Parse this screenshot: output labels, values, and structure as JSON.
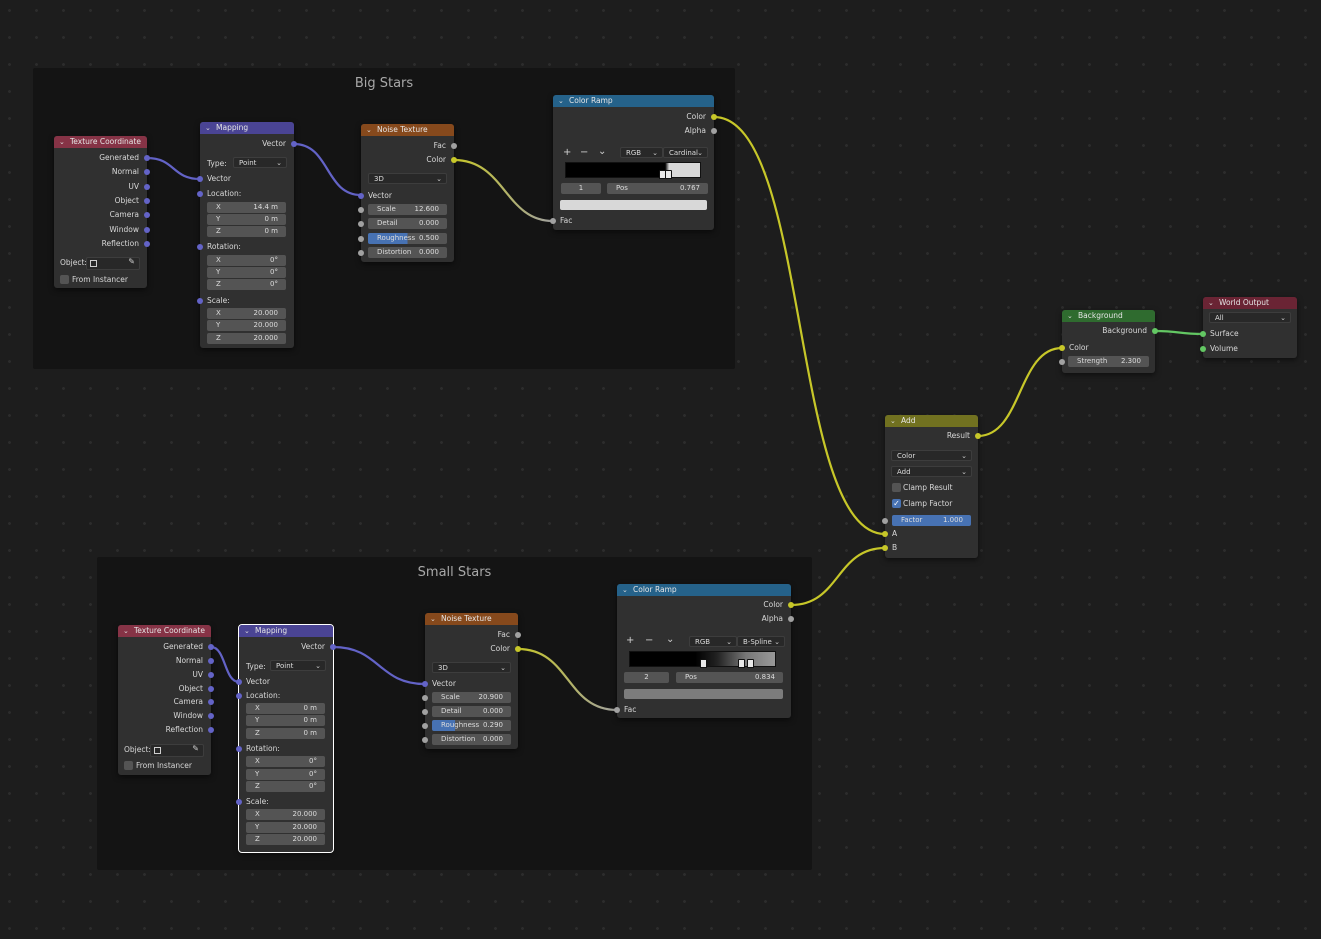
{
  "frames": {
    "big_stars": "Big Stars",
    "small_stars": "Small Stars"
  },
  "texture_coordinate": {
    "title": "Texture Coordinate",
    "outputs": [
      "Generated",
      "Normal",
      "UV",
      "Object",
      "Camera",
      "Window",
      "Reflection"
    ],
    "object_label": "Object:",
    "from_instancer": "From Instancer"
  },
  "mapping_big": {
    "title": "Mapping",
    "vector_out": "Vector",
    "type_label": "Type:",
    "type_value": "Point",
    "vector_in": "Vector",
    "location_label": "Location:",
    "location": [
      [
        "X",
        "14.4 m"
      ],
      [
        "Y",
        "0 m"
      ],
      [
        "Z",
        "0 m"
      ]
    ],
    "rotation_label": "Rotation:",
    "rotation": [
      [
        "X",
        "0°"
      ],
      [
        "Y",
        "0°"
      ],
      [
        "Z",
        "0°"
      ]
    ],
    "scale_label": "Scale:",
    "scale": [
      [
        "X",
        "20.000"
      ],
      [
        "Y",
        "20.000"
      ],
      [
        "Z",
        "20.000"
      ]
    ]
  },
  "mapping_small": {
    "title": "Mapping",
    "vector_out": "Vector",
    "type_label": "Type:",
    "type_value": "Point",
    "vector_in": "Vector",
    "location_label": "Location:",
    "location": [
      [
        "X",
        "0 m"
      ],
      [
        "Y",
        "0 m"
      ],
      [
        "Z",
        "0 m"
      ]
    ],
    "rotation_label": "Rotation:",
    "rotation": [
      [
        "X",
        "0°"
      ],
      [
        "Y",
        "0°"
      ],
      [
        "Z",
        "0°"
      ]
    ],
    "scale_label": "Scale:",
    "scale": [
      [
        "X",
        "20.000"
      ],
      [
        "Y",
        "20.000"
      ],
      [
        "Z",
        "20.000"
      ]
    ]
  },
  "noise_big": {
    "title": "Noise Texture",
    "fac": "Fac",
    "color": "Color",
    "dimension": "3D",
    "vector": "Vector",
    "fields": [
      [
        "Scale",
        "12.600"
      ],
      [
        "Detail",
        "0.000"
      ],
      [
        "Roughness",
        "0.500"
      ],
      [
        "Distortion",
        "0.000"
      ]
    ],
    "roughness_fill": 0.5
  },
  "noise_small": {
    "title": "Noise Texture",
    "fac": "Fac",
    "color": "Color",
    "dimension": "3D",
    "vector": "Vector",
    "fields": [
      [
        "Scale",
        "20.900"
      ],
      [
        "Detail",
        "0.000"
      ],
      [
        "Roughness",
        "0.290"
      ],
      [
        "Distortion",
        "0.000"
      ]
    ],
    "roughness_fill": 0.29
  },
  "ramp_big": {
    "title": "Color Ramp",
    "color": "Color",
    "alpha": "Alpha",
    "tool_add": "+",
    "tool_remove": "−",
    "tool_more": "⌄",
    "mode": "RGB",
    "interp": "Cardinal",
    "index": "1",
    "pos_label": "Pos",
    "pos_value": "0.767",
    "fac": "Fac"
  },
  "ramp_small": {
    "title": "Color Ramp",
    "color": "Color",
    "alpha": "Alpha",
    "tool_add": "+",
    "tool_remove": "−",
    "tool_more": "⌄",
    "mode": "RGB",
    "interp": "B-Spline",
    "index": "2",
    "pos_label": "Pos",
    "pos_value": "0.834",
    "fac": "Fac"
  },
  "add_node": {
    "title": "Add",
    "result": "Result",
    "data_type": "Color",
    "blend": "Add",
    "clamp_result": "Clamp Result",
    "clamp_factor": "Clamp Factor",
    "factor_label": "Factor",
    "factor_value": "1.000",
    "a": "A",
    "b": "B"
  },
  "background_node": {
    "title": "Background",
    "out": "Background",
    "color": "Color",
    "strength_label": "Strength",
    "strength_value": "2.300"
  },
  "world_output": {
    "title": "World Output",
    "target": "All",
    "surface": "Surface",
    "volume": "Volume"
  },
  "colors": {
    "socket_vector": "#6363c7",
    "socket_color": "#c7c729",
    "socket_float": "#a1a1a1",
    "socket_shader": "#63c763",
    "header_texture": "#863346",
    "header_vector": "#4a4494",
    "header_noise": "#86491c",
    "header_ramp": "#25628a",
    "header_mix": "#717120",
    "header_shader": "#2f6b2f",
    "header_output": "#6a2434",
    "highlight": "#4772b3"
  },
  "icons": {
    "collapse": "chevron-down-icon",
    "eyedropper": "eyedropper-icon",
    "checkbox": "checkbox-icon"
  }
}
